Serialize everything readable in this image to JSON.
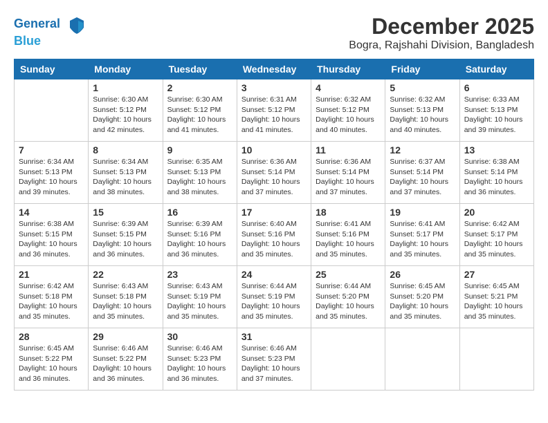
{
  "logo": {
    "line1": "General",
    "line2": "Blue"
  },
  "title": "December 2025",
  "subtitle": "Bogra, Rajshahi Division, Bangladesh",
  "days_of_week": [
    "Sunday",
    "Monday",
    "Tuesday",
    "Wednesday",
    "Thursday",
    "Friday",
    "Saturday"
  ],
  "weeks": [
    [
      {
        "day": "",
        "info": ""
      },
      {
        "day": "1",
        "sunrise": "Sunrise: 6:30 AM",
        "sunset": "Sunset: 5:12 PM",
        "daylight": "Daylight: 10 hours and 42 minutes."
      },
      {
        "day": "2",
        "sunrise": "Sunrise: 6:30 AM",
        "sunset": "Sunset: 5:12 PM",
        "daylight": "Daylight: 10 hours and 41 minutes."
      },
      {
        "day": "3",
        "sunrise": "Sunrise: 6:31 AM",
        "sunset": "Sunset: 5:12 PM",
        "daylight": "Daylight: 10 hours and 41 minutes."
      },
      {
        "day": "4",
        "sunrise": "Sunrise: 6:32 AM",
        "sunset": "Sunset: 5:12 PM",
        "daylight": "Daylight: 10 hours and 40 minutes."
      },
      {
        "day": "5",
        "sunrise": "Sunrise: 6:32 AM",
        "sunset": "Sunset: 5:13 PM",
        "daylight": "Daylight: 10 hours and 40 minutes."
      },
      {
        "day": "6",
        "sunrise": "Sunrise: 6:33 AM",
        "sunset": "Sunset: 5:13 PM",
        "daylight": "Daylight: 10 hours and 39 minutes."
      }
    ],
    [
      {
        "day": "7",
        "sunrise": "Sunrise: 6:34 AM",
        "sunset": "Sunset: 5:13 PM",
        "daylight": "Daylight: 10 hours and 39 minutes."
      },
      {
        "day": "8",
        "sunrise": "Sunrise: 6:34 AM",
        "sunset": "Sunset: 5:13 PM",
        "daylight": "Daylight: 10 hours and 38 minutes."
      },
      {
        "day": "9",
        "sunrise": "Sunrise: 6:35 AM",
        "sunset": "Sunset: 5:13 PM",
        "daylight": "Daylight: 10 hours and 38 minutes."
      },
      {
        "day": "10",
        "sunrise": "Sunrise: 6:36 AM",
        "sunset": "Sunset: 5:14 PM",
        "daylight": "Daylight: 10 hours and 37 minutes."
      },
      {
        "day": "11",
        "sunrise": "Sunrise: 6:36 AM",
        "sunset": "Sunset: 5:14 PM",
        "daylight": "Daylight: 10 hours and 37 minutes."
      },
      {
        "day": "12",
        "sunrise": "Sunrise: 6:37 AM",
        "sunset": "Sunset: 5:14 PM",
        "daylight": "Daylight: 10 hours and 37 minutes."
      },
      {
        "day": "13",
        "sunrise": "Sunrise: 6:38 AM",
        "sunset": "Sunset: 5:14 PM",
        "daylight": "Daylight: 10 hours and 36 minutes."
      }
    ],
    [
      {
        "day": "14",
        "sunrise": "Sunrise: 6:38 AM",
        "sunset": "Sunset: 5:15 PM",
        "daylight": "Daylight: 10 hours and 36 minutes."
      },
      {
        "day": "15",
        "sunrise": "Sunrise: 6:39 AM",
        "sunset": "Sunset: 5:15 PM",
        "daylight": "Daylight: 10 hours and 36 minutes."
      },
      {
        "day": "16",
        "sunrise": "Sunrise: 6:39 AM",
        "sunset": "Sunset: 5:16 PM",
        "daylight": "Daylight: 10 hours and 36 minutes."
      },
      {
        "day": "17",
        "sunrise": "Sunrise: 6:40 AM",
        "sunset": "Sunset: 5:16 PM",
        "daylight": "Daylight: 10 hours and 35 minutes."
      },
      {
        "day": "18",
        "sunrise": "Sunrise: 6:41 AM",
        "sunset": "Sunset: 5:16 PM",
        "daylight": "Daylight: 10 hours and 35 minutes."
      },
      {
        "day": "19",
        "sunrise": "Sunrise: 6:41 AM",
        "sunset": "Sunset: 5:17 PM",
        "daylight": "Daylight: 10 hours and 35 minutes."
      },
      {
        "day": "20",
        "sunrise": "Sunrise: 6:42 AM",
        "sunset": "Sunset: 5:17 PM",
        "daylight": "Daylight: 10 hours and 35 minutes."
      }
    ],
    [
      {
        "day": "21",
        "sunrise": "Sunrise: 6:42 AM",
        "sunset": "Sunset: 5:18 PM",
        "daylight": "Daylight: 10 hours and 35 minutes."
      },
      {
        "day": "22",
        "sunrise": "Sunrise: 6:43 AM",
        "sunset": "Sunset: 5:18 PM",
        "daylight": "Daylight: 10 hours and 35 minutes."
      },
      {
        "day": "23",
        "sunrise": "Sunrise: 6:43 AM",
        "sunset": "Sunset: 5:19 PM",
        "daylight": "Daylight: 10 hours and 35 minutes."
      },
      {
        "day": "24",
        "sunrise": "Sunrise: 6:44 AM",
        "sunset": "Sunset: 5:19 PM",
        "daylight": "Daylight: 10 hours and 35 minutes."
      },
      {
        "day": "25",
        "sunrise": "Sunrise: 6:44 AM",
        "sunset": "Sunset: 5:20 PM",
        "daylight": "Daylight: 10 hours and 35 minutes."
      },
      {
        "day": "26",
        "sunrise": "Sunrise: 6:45 AM",
        "sunset": "Sunset: 5:20 PM",
        "daylight": "Daylight: 10 hours and 35 minutes."
      },
      {
        "day": "27",
        "sunrise": "Sunrise: 6:45 AM",
        "sunset": "Sunset: 5:21 PM",
        "daylight": "Daylight: 10 hours and 35 minutes."
      }
    ],
    [
      {
        "day": "28",
        "sunrise": "Sunrise: 6:45 AM",
        "sunset": "Sunset: 5:22 PM",
        "daylight": "Daylight: 10 hours and 36 minutes."
      },
      {
        "day": "29",
        "sunrise": "Sunrise: 6:46 AM",
        "sunset": "Sunset: 5:22 PM",
        "daylight": "Daylight: 10 hours and 36 minutes."
      },
      {
        "day": "30",
        "sunrise": "Sunrise: 6:46 AM",
        "sunset": "Sunset: 5:23 PM",
        "daylight": "Daylight: 10 hours and 36 minutes."
      },
      {
        "day": "31",
        "sunrise": "Sunrise: 6:46 AM",
        "sunset": "Sunset: 5:23 PM",
        "daylight": "Daylight: 10 hours and 37 minutes."
      },
      {
        "day": "",
        "info": ""
      },
      {
        "day": "",
        "info": ""
      },
      {
        "day": "",
        "info": ""
      }
    ]
  ]
}
